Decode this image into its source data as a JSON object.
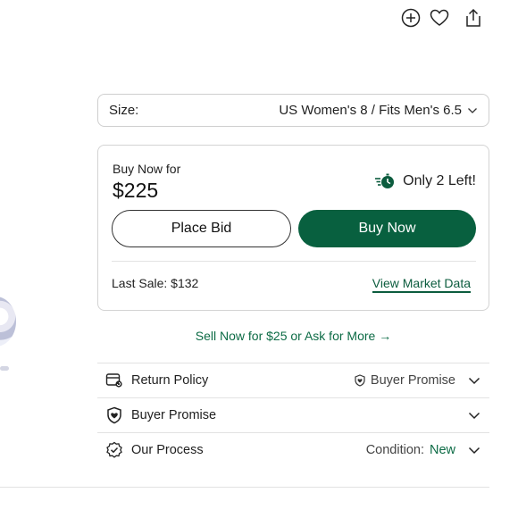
{
  "top_actions": {
    "add_icon": "plus-circle",
    "favorite_icon": "heart",
    "share_icon": "share-upload"
  },
  "size": {
    "label": "Size:",
    "value": "US Women's 8 / Fits Men's 6.5"
  },
  "buy_box": {
    "buy_now_for": "Buy Now for",
    "price": "$225",
    "stock_text": "Only 2 Left!",
    "place_bid_label": "Place Bid",
    "buy_now_label": "Buy Now",
    "last_sale": "Last Sale: $132",
    "market_data_link": "View Market Data"
  },
  "sell_now": {
    "text": "Sell Now for $25 or Ask for More →"
  },
  "accordion": [
    {
      "title": "Return Policy",
      "right_text": "Buyer Promise",
      "icon": "return-box"
    },
    {
      "title": "Buyer Promise",
      "icon": "heart-shield"
    },
    {
      "title": "Our Process",
      "condition_label": "Condition:",
      "condition_value": "New",
      "icon": "verified-badge"
    }
  ],
  "colors": {
    "brand_green": "#08603f",
    "link_green": "#0c5c3e"
  }
}
